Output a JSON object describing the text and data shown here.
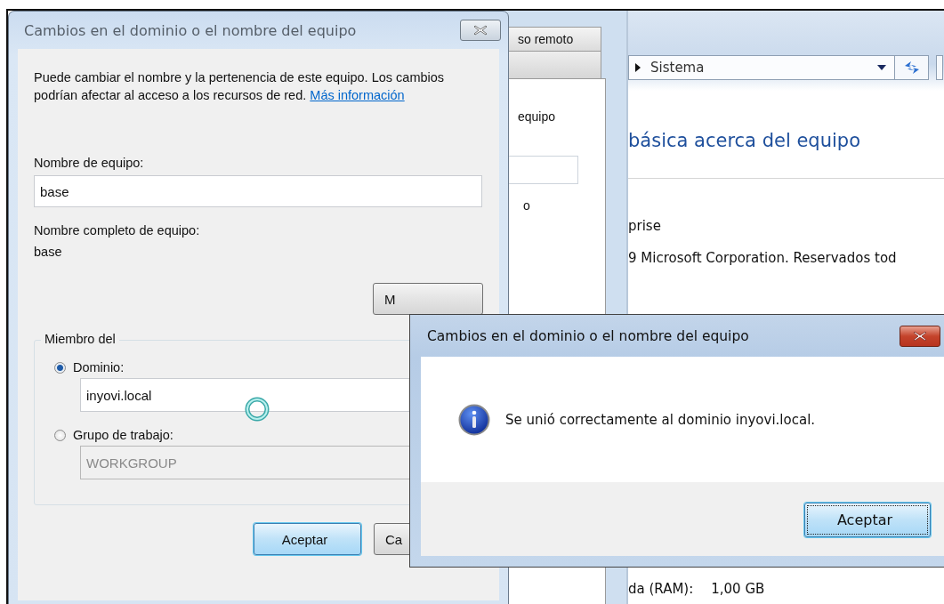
{
  "system_window": {
    "breadcrumb": "Sistema",
    "heading": "básica acerca del equipo",
    "lines": [
      "prise",
      "9 Microsoft Corporation. Reservados tod"
    ],
    "specs": [
      {
        "label": "da (RAM):",
        "value": "1,00 GB"
      }
    ]
  },
  "properties_dialog": {
    "tabs": [
      {
        "label": "so remoto",
        "selected": false
      }
    ],
    "description": "equipo",
    "option_text": "o"
  },
  "dialog": {
    "title": "Cambios en el dominio o el nombre del equipo",
    "intro": "Puede cambiar el nombre y la pertenencia de este equipo. Los cambios podrían afectar al acceso a los recursos de red.",
    "link": "Más información",
    "computer_name_label": "Nombre de equipo:",
    "computer_name": "base",
    "full_name_label": "Nombre completo de equipo:",
    "full_name": "base",
    "more_button": "M",
    "member_group": {
      "legend": "Miembro del",
      "options": [
        {
          "label": "Dominio:",
          "selected": true,
          "value": "inyovi.local",
          "disabled": false
        },
        {
          "label": "Grupo de trabajo:",
          "selected": false,
          "value": "WORKGROUP",
          "disabled": true
        }
      ]
    },
    "buttons": [
      {
        "label": "Aceptar",
        "default": true
      },
      {
        "label": "Ca",
        "default": false
      }
    ]
  },
  "message_box": {
    "title": "Cambios en el dominio o el nombre del equipo",
    "message": "Se unió correctamente al dominio inyovi.local.",
    "buttons": [
      {
        "label": "Aceptar",
        "focused": true
      }
    ]
  }
}
